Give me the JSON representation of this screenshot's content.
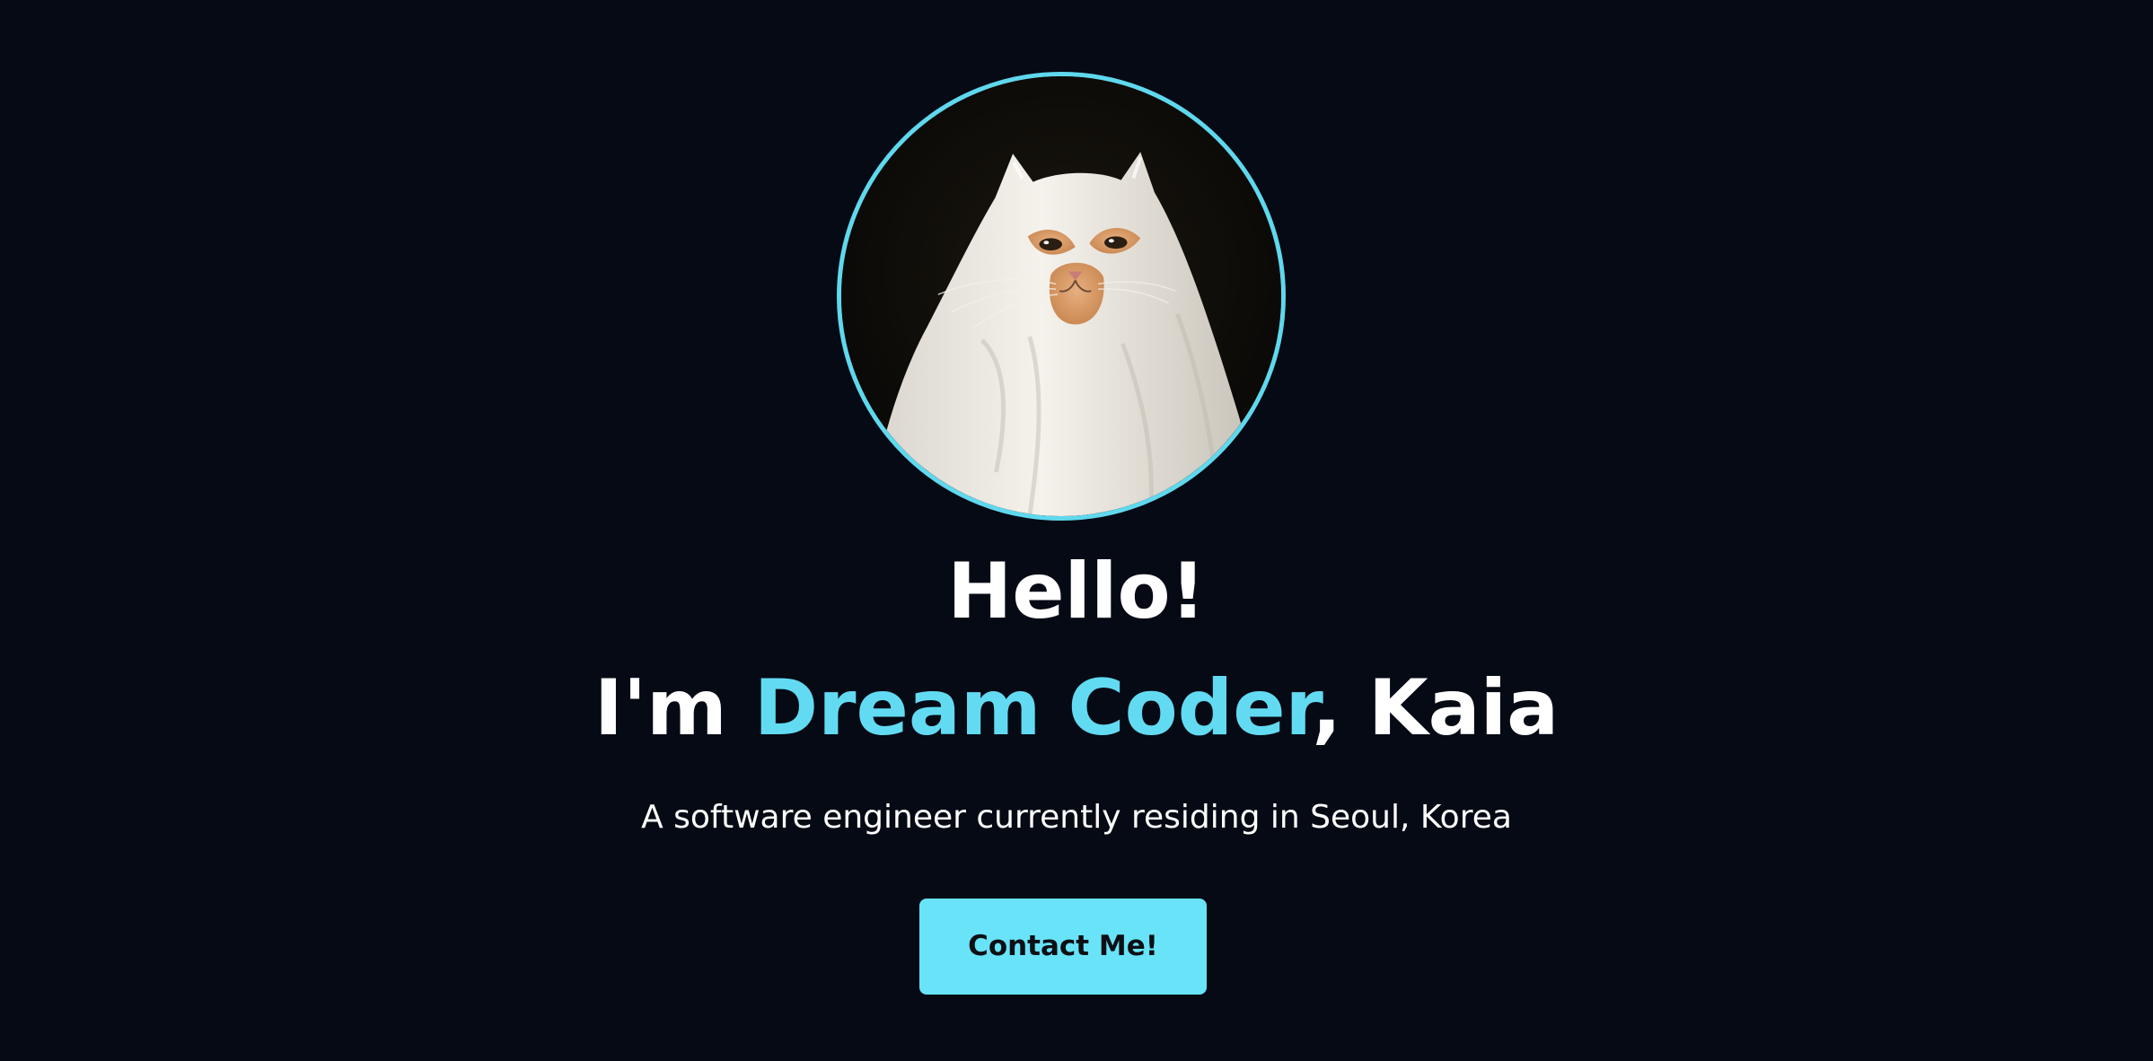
{
  "hero": {
    "avatar_label": "ghost-cat-avatar",
    "greeting": "Hello!",
    "intro_prefix": "I'm ",
    "intro_highlight": "Dream Coder",
    "intro_suffix": ", Kaia",
    "description": "A software engineer currently residing in Seoul, Korea",
    "contact_button_label": "Contact Me!"
  },
  "colors": {
    "background": "#050a14",
    "accent": "#62dbf2",
    "button": "#68e3f7",
    "text": "#ffffff"
  }
}
